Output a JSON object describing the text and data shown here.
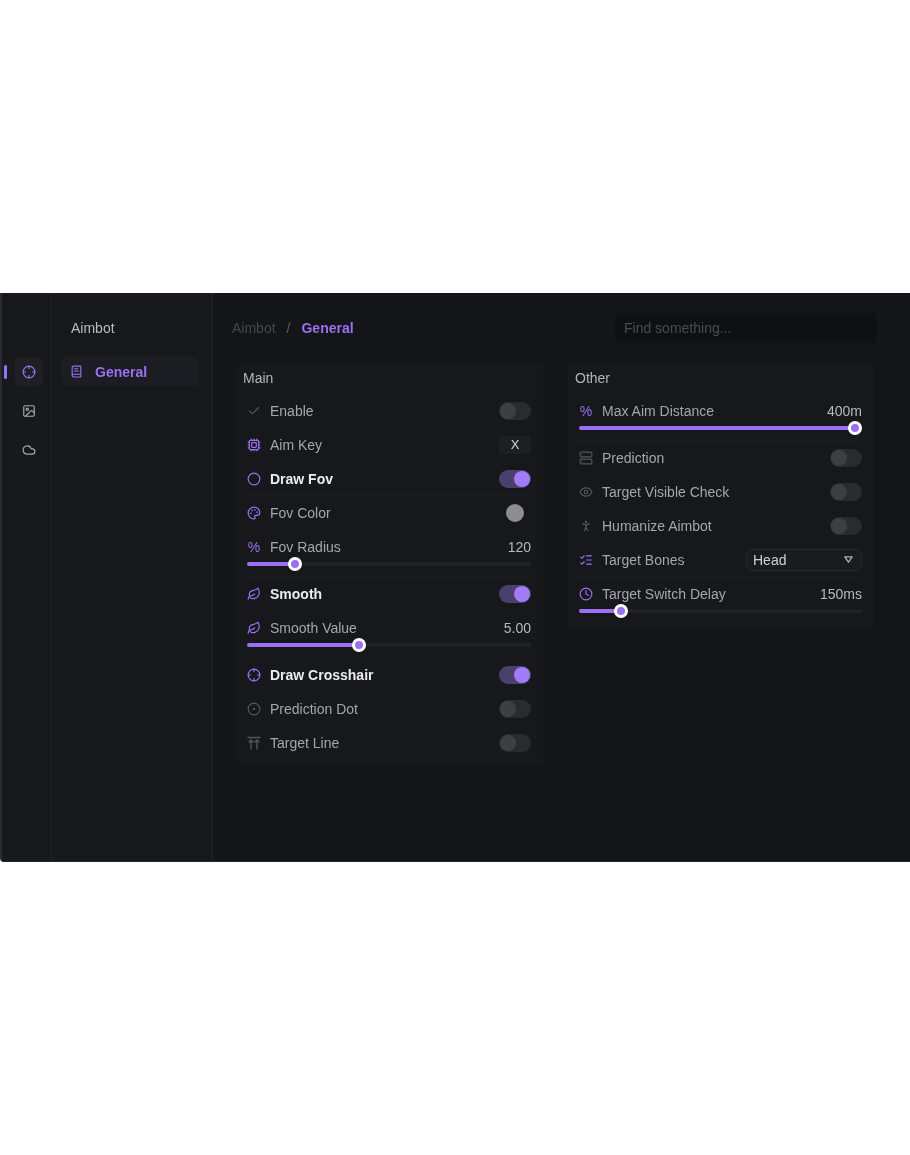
{
  "rail": {
    "items": [
      {
        "selected": true
      },
      {
        "selected": false
      },
      {
        "selected": false
      }
    ]
  },
  "sidebar": {
    "title": "Aimbot",
    "items": [
      {
        "label": "General",
        "selected": true
      }
    ]
  },
  "breadcrumb": {
    "items": [
      {
        "label": "Aimbot",
        "selected": false
      },
      {
        "label": "General",
        "selected": true
      }
    ],
    "separator": "/"
  },
  "search": {
    "placeholder": "Find something..."
  },
  "panels": [
    {
      "title": "Main",
      "rows": [
        {
          "kind": "toggle",
          "label": "Enable",
          "on": false
        },
        {
          "kind": "key",
          "label": "Aim Key",
          "value": "X"
        },
        {
          "kind": "toggle",
          "label": "Draw Fov",
          "on": true
        },
        {
          "kind": "color",
          "label": "Fov Color",
          "color": "#8e8e90"
        },
        {
          "kind": "slider",
          "symbol": "%",
          "label": "Fov Radius",
          "reading": "120",
          "level": 0.15
        },
        {
          "kind": "toggle",
          "label": "Smooth",
          "on": true
        },
        {
          "kind": "slider",
          "label": "Smooth Value",
          "reading": "5.00",
          "level": 0.39
        },
        {
          "kind": "toggle",
          "label": "Draw Crosshair",
          "on": true
        },
        {
          "kind": "toggle",
          "label": "Prediction Dot",
          "on": false
        },
        {
          "kind": "toggle",
          "label": "Target Line",
          "on": false
        }
      ]
    },
    {
      "title": "Other",
      "rows": [
        {
          "kind": "slider",
          "symbol": "%",
          "label": "Max Aim Distance",
          "reading": "400m",
          "level": 1
        },
        {
          "kind": "toggle",
          "label": "Prediction",
          "on": false
        },
        {
          "kind": "toggle",
          "label": "Target Visible Check",
          "on": false
        },
        {
          "kind": "toggle",
          "label": "Humanize Aimbot",
          "on": false
        },
        {
          "kind": "select",
          "label": "Target Bones",
          "value": "Head"
        },
        {
          "kind": "slider",
          "label": "Target Switch Delay",
          "reading": "150ms",
          "level": 0.13
        }
      ]
    }
  ]
}
